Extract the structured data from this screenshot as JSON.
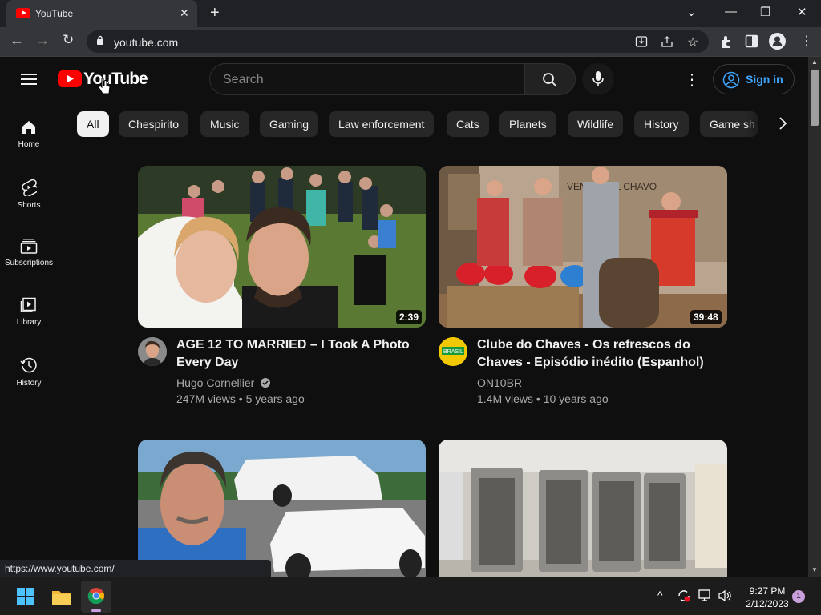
{
  "browser": {
    "tab_title": "YouTube",
    "url": "youtube.com",
    "status_url": "https://www.youtube.com/"
  },
  "header": {
    "logo_text": "YouTube",
    "search_placeholder": "Search",
    "signin_label": "Sign in"
  },
  "sidebar": {
    "items": [
      {
        "label": "Home",
        "icon": "home-icon"
      },
      {
        "label": "Shorts",
        "icon": "shorts-icon"
      },
      {
        "label": "Subscriptions",
        "icon": "subscriptions-icon"
      },
      {
        "label": "Library",
        "icon": "library-icon"
      },
      {
        "label": "History",
        "icon": "history-icon"
      }
    ]
  },
  "chips": [
    "All",
    "Chespirito",
    "Music",
    "Gaming",
    "Law enforcement",
    "Cats",
    "Planets",
    "Wildlife",
    "History",
    "Game sh"
  ],
  "videos": [
    {
      "title": "AGE 12 TO MARRIED – I Took A Photo Every Day",
      "channel": "Hugo Cornellier",
      "verified": true,
      "meta": "247M views • 5 years ago",
      "duration": "2:39"
    },
    {
      "title": "Clube do Chaves - Os refrescos do Chaves - Episódio inédito (Espanhol)",
      "channel": "ON10BR",
      "verified": false,
      "meta": "1.4M views • 10 years ago",
      "duration": "39:48"
    }
  ],
  "taskbar": {
    "time": "9:27 PM",
    "date": "2/12/2023",
    "notifications": "1"
  },
  "colors": {
    "brand": "#ff0000",
    "link": "#3ea6ff",
    "background": "#0f0f0f"
  }
}
